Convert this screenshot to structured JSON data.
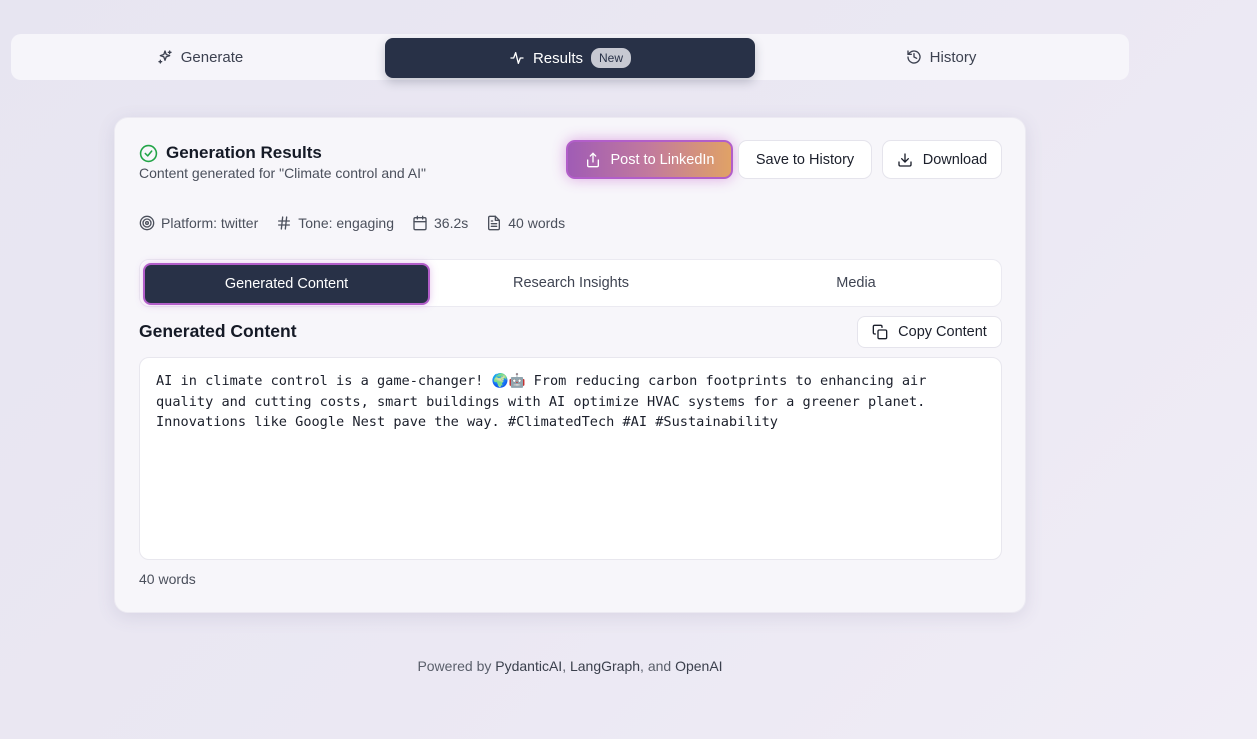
{
  "tabs": {
    "generate": "Generate",
    "results": "Results",
    "results_badge": "New",
    "history": "History"
  },
  "card": {
    "title": "Generation Results",
    "subtitle": "Content generated for \"Climate control and AI\"",
    "buttons": {
      "linkedin": "Post to LinkedIn",
      "save": "Save to History",
      "download": "Download"
    },
    "meta": {
      "platform": "Platform: twitter",
      "tone": "Tone: engaging",
      "time": "36.2s",
      "words": "40 words"
    },
    "content_tabs": {
      "generated": "Generated Content",
      "research": "Research Insights",
      "media": "Media"
    },
    "section_title": "Generated Content",
    "copy_label": "Copy Content",
    "content_text": "AI in climate control is a game-changer! 🌍🤖 From reducing carbon footprints to enhancing air quality and cutting costs, smart buildings with AI optimize HVAC systems for a greener planet. Innovations like Google Nest pave the way. #ClimatedTech #AI #Sustainability",
    "word_count": "40 words"
  },
  "footer": {
    "prefix": "Powered by ",
    "pydantic": "PydanticAI",
    "sep1": ", ",
    "langgraph": "LangGraph",
    "sep2": ", and ",
    "openai": "OpenAI"
  },
  "colors": {
    "dark": "#283147",
    "accent_glow": "#b25ec9",
    "success": "#22a447"
  },
  "icons": {
    "generate": "sparkles-icon",
    "results": "activity-icon",
    "history": "history-icon",
    "success": "check-circle-icon",
    "share": "share-icon",
    "download": "download-icon",
    "platform": "target-icon",
    "tone": "hash-icon",
    "time": "calendar-icon",
    "words": "file-text-icon",
    "copy": "copy-icon"
  }
}
